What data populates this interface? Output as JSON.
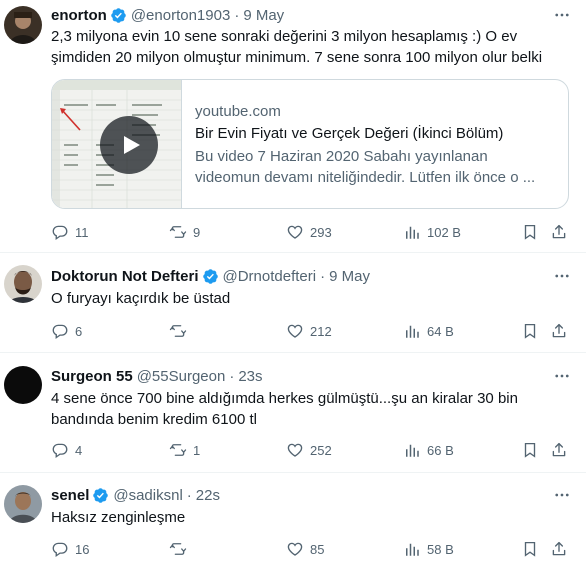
{
  "tweets": [
    {
      "name": "enorton",
      "handle": "@enorton1903",
      "time": "9 May",
      "text_lines": [
        "2,3 milyona evin 10 sene sonraki değerini 3  milyon hesaplamış :) O ev",
        "şimdiden 20 milyon olmuştur minimum. 7 sene sonra 100 milyon olur belki"
      ],
      "card": {
        "domain": "youtube.com",
        "title": "Bir Evin Fiyatı ve Gerçek Değeri (İkinci Bölüm)",
        "desc_lines": [
          "Bu video 7 Haziran 2020 Sabahı yayınlanan",
          "videomun devamı niteliğindedir. Lütfen ilk önce o ..."
        ]
      },
      "replies": "11",
      "retweets": "9",
      "likes": "293",
      "views": "102 B"
    },
    {
      "name": "Doktorun Not Defteri",
      "handle": "@Drnotdefteri",
      "time": "9 May",
      "text_lines": [
        "O furyayı kaçırdık be üstad"
      ],
      "replies": "6",
      "retweets": "",
      "likes": "212",
      "views": "64 B"
    },
    {
      "name": "Surgeon 55",
      "handle": "@55Surgeon",
      "time": "23s",
      "text_lines": [
        "4 sene önce 700 bine aldığımda herkes gülmüştü...şu an kiralar 30 bin",
        "bandında benim kredim 6100 tl"
      ],
      "replies": "4",
      "retweets": "1",
      "likes": "252",
      "views": "66 B"
    },
    {
      "name": "senel",
      "handle": "@sadiksnl",
      "time": "22s",
      "text_lines": [
        "Haksız zenginleşme"
      ],
      "replies": "16",
      "retweets": "",
      "likes": "85",
      "views": "58 B"
    }
  ],
  "colors": {
    "text": "#0f1419",
    "secondary": "#536471",
    "verified": "#1d9bf0",
    "border": "#eff3f4"
  }
}
